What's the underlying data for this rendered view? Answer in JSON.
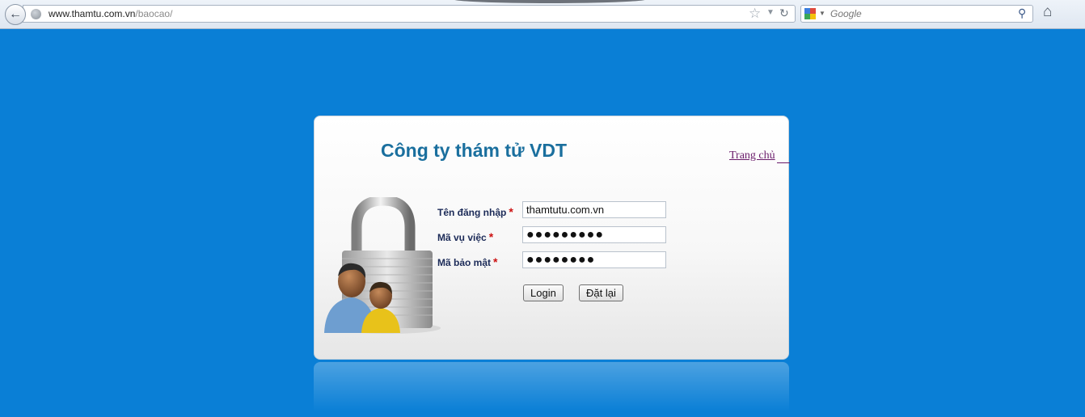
{
  "browser": {
    "url_domain": "www.thamtu.com.vn",
    "url_path": "/baocao/",
    "search_placeholder": "Google"
  },
  "login": {
    "title": "Công ty thám tử VDT",
    "home_link": "Trang chủ",
    "fields": [
      {
        "label": "Tên đăng nhập",
        "required": "*",
        "value": "thamtutu.com.vn",
        "type": "text"
      },
      {
        "label": "Mã vụ việc",
        "required": "*",
        "value": "●●●●●●●●●",
        "type": "password"
      },
      {
        "label": "Mã bảo mật",
        "required": "*",
        "value": "●●●●●●●●",
        "type": "password"
      }
    ],
    "login_button": "Login",
    "reset_button": "Đặt lại"
  },
  "icons": {
    "back": "back-arrow-icon",
    "site": "globe-icon",
    "bookmark": "star-icon",
    "reload": "reload-icon",
    "search_engine": "google-icon",
    "search": "magnifier-icon",
    "home": "home-icon",
    "illustration": "padlock-users-icon"
  },
  "colors": {
    "page_background": "#0a7fd6",
    "title": "#1a6f9e",
    "label": "#1c2b58",
    "required": "#cc1111",
    "link": "#6a1b6a"
  }
}
